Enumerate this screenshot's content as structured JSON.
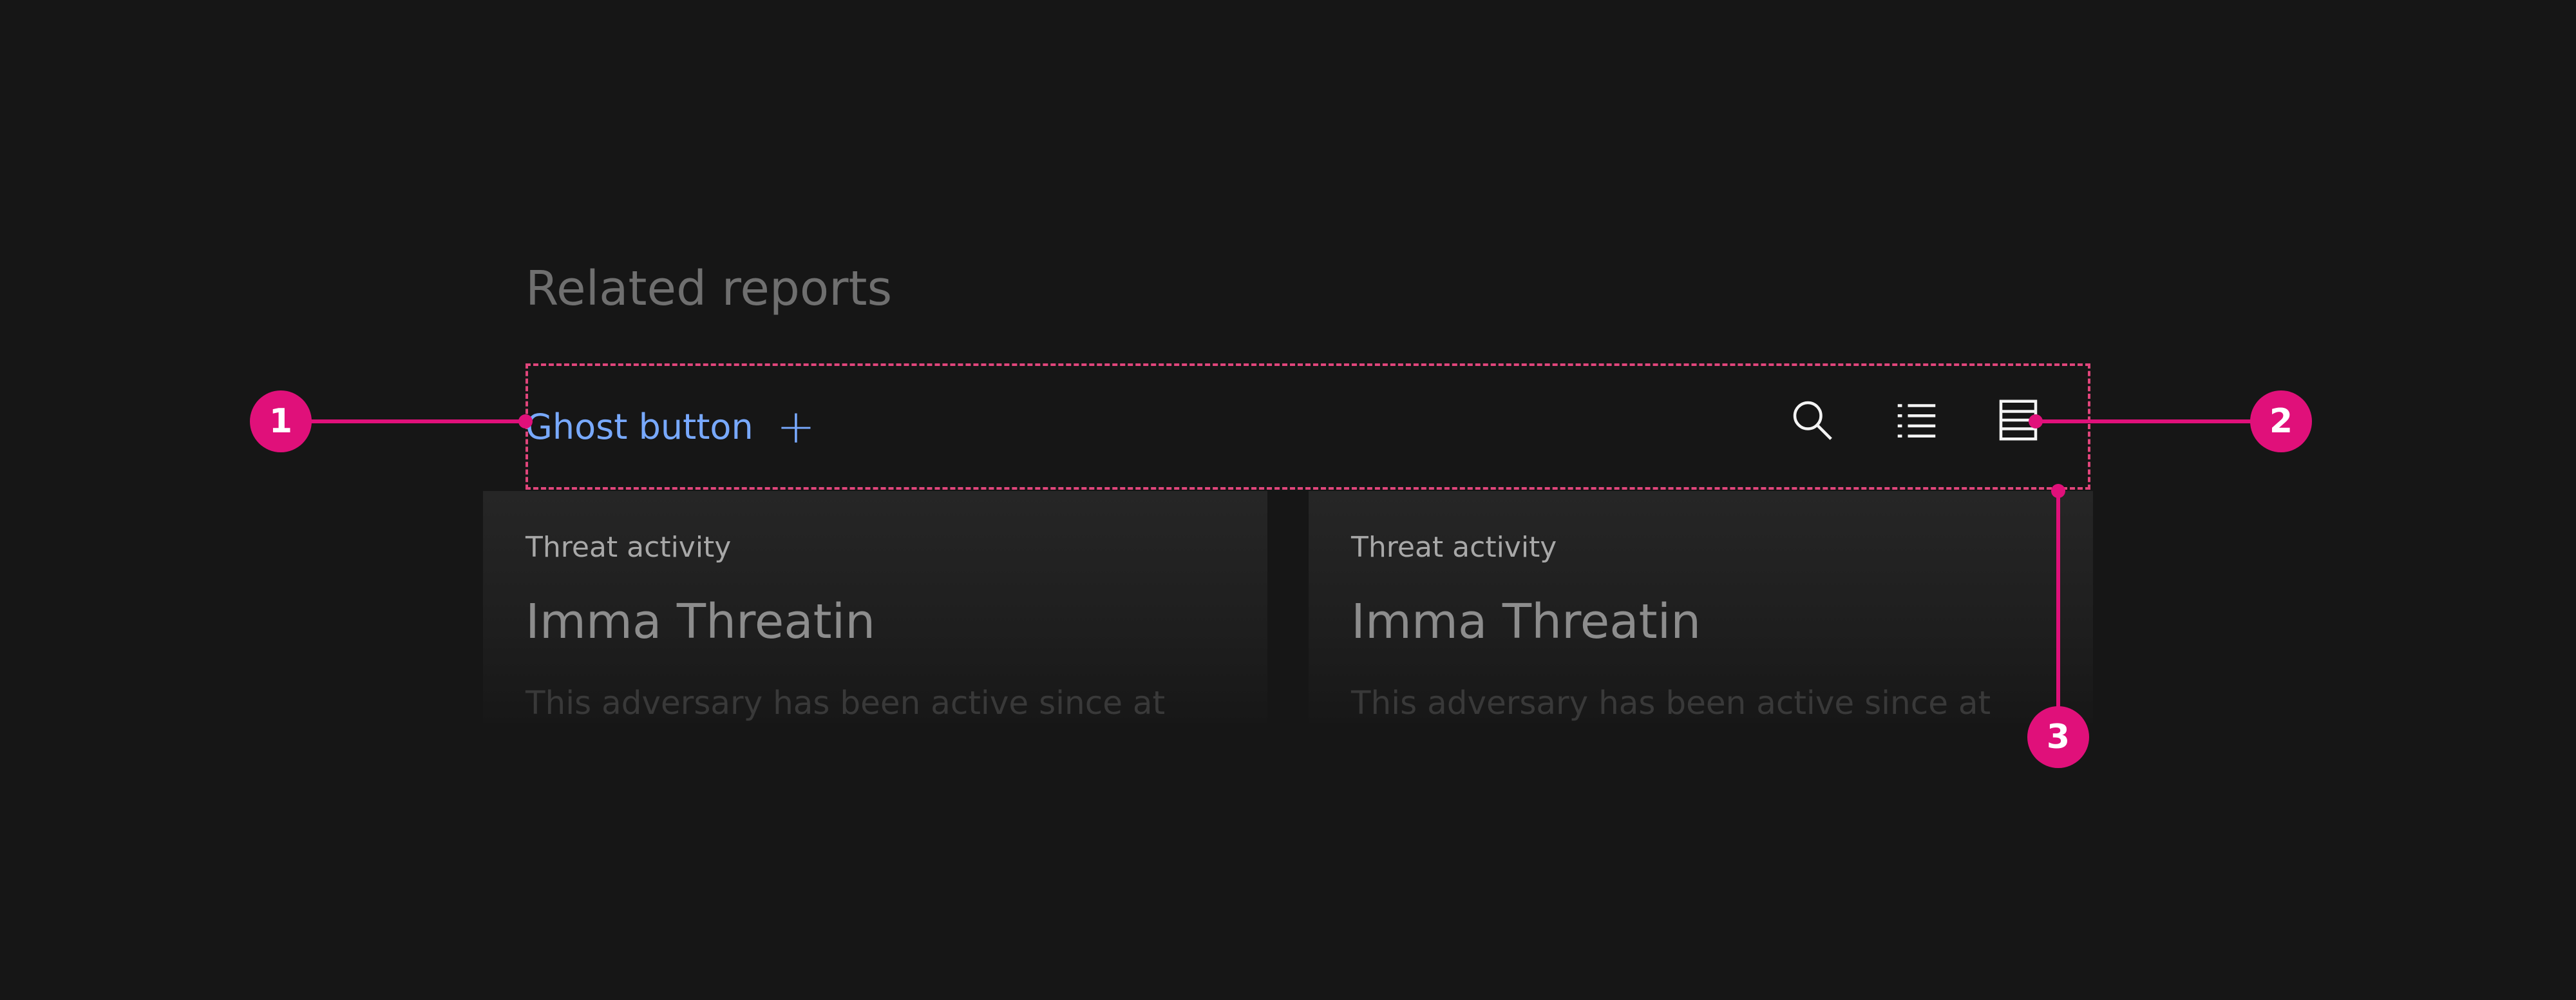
{
  "section": {
    "title": "Related reports"
  },
  "toolbar": {
    "ghost_button_label": "Ghost button",
    "ghost_button_icon": "+",
    "icons": [
      "search-icon",
      "list-icon",
      "table-view-icon"
    ]
  },
  "cards": [
    {
      "eyebrow": "Threat activity",
      "title": "Imma Threatin",
      "body": "This adversary has been active since at"
    },
    {
      "eyebrow": "Threat activity",
      "title": "Imma Threatin",
      "body": "This adversary has been active since at"
    }
  ],
  "callouts": [
    "1",
    "2",
    "3"
  ],
  "colors": {
    "background": "#161616",
    "accent_link": "#78a9ff",
    "callout": "#e0107a",
    "frame_dash": "#e0457b"
  }
}
